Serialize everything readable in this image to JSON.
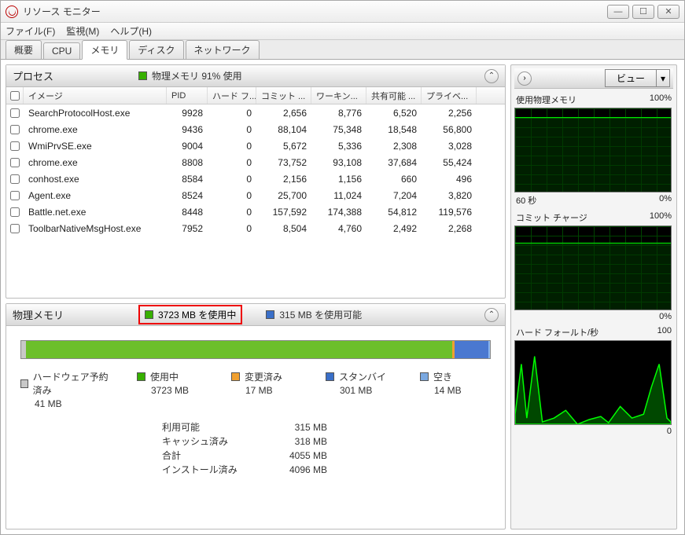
{
  "window": {
    "title": "リソース モニター"
  },
  "menu": {
    "file": "ファイル(F)",
    "monitor": "監視(M)",
    "help": "ヘルプ(H)"
  },
  "tabs": {
    "overview": "概要",
    "cpu": "CPU",
    "memory": "メモリ",
    "disk": "ディスク",
    "network": "ネットワーク"
  },
  "process_panel": {
    "title": "プロセス",
    "status": "物理メモリ 91% 使用",
    "cols": {
      "image": "イメージ",
      "pid": "PID",
      "hardfault": "ハード フ...",
      "commit": "コミット ...",
      "working": "ワーキン...",
      "shareable": "共有可能 ...",
      "private": "プライベ..."
    },
    "rows": [
      {
        "img": "SearchProtocolHost.exe",
        "pid": "9928",
        "hf": "0",
        "cm": "2,656",
        "ws": "8,776",
        "sh": "6,520",
        "pv": "2,256"
      },
      {
        "img": "chrome.exe",
        "pid": "9436",
        "hf": "0",
        "cm": "88,104",
        "ws": "75,348",
        "sh": "18,548",
        "pv": "56,800"
      },
      {
        "img": "WmiPrvSE.exe",
        "pid": "9004",
        "hf": "0",
        "cm": "5,672",
        "ws": "5,336",
        "sh": "2,308",
        "pv": "3,028"
      },
      {
        "img": "chrome.exe",
        "pid": "8808",
        "hf": "0",
        "cm": "73,752",
        "ws": "93,108",
        "sh": "37,684",
        "pv": "55,424"
      },
      {
        "img": "conhost.exe",
        "pid": "8584",
        "hf": "0",
        "cm": "2,156",
        "ws": "1,156",
        "sh": "660",
        "pv": "496"
      },
      {
        "img": "Agent.exe",
        "pid": "8524",
        "hf": "0",
        "cm": "25,700",
        "ws": "11,024",
        "sh": "7,204",
        "pv": "3,820"
      },
      {
        "img": "Battle.net.exe",
        "pid": "8448",
        "hf": "0",
        "cm": "157,592",
        "ws": "174,388",
        "sh": "54,812",
        "pv": "119,576"
      },
      {
        "img": "ToolbarNativeMsgHost.exe",
        "pid": "7952",
        "hf": "0",
        "cm": "8,504",
        "ws": "4,760",
        "sh": "2,492",
        "pv": "2,268"
      }
    ]
  },
  "memory_panel": {
    "title": "物理メモリ",
    "used_label": "3723 MB を使用中",
    "avail_label": "315 MB を使用可能",
    "bar": {
      "hw_pct": 1.0,
      "used_pct": 91.0,
      "mod_pct": 0.4,
      "sb_pct": 7.3,
      "free_pct": 0.3
    },
    "legend": {
      "hw": {
        "label": "ハードウェア予約済み",
        "value": "41 MB"
      },
      "used": {
        "label": "使用中",
        "value": "3723 MB"
      },
      "mod": {
        "label": "変更済み",
        "value": "17 MB"
      },
      "sb": {
        "label": "スタンバイ",
        "value": "301 MB"
      },
      "free": {
        "label": "空き",
        "value": "14 MB"
      }
    },
    "summary": {
      "avail": {
        "label": "利用可能",
        "value": "315 MB"
      },
      "cached": {
        "label": "キャッシュ済み",
        "value": "318 MB"
      },
      "total": {
        "label": "合計",
        "value": "4055 MB"
      },
      "installed": {
        "label": "インストール済み",
        "value": "4096 MB"
      }
    }
  },
  "right": {
    "view_btn": "ビュー",
    "graphs": {
      "used": {
        "title": "使用物理メモリ",
        "max": "100%",
        "left": "60 秒",
        "right": "0%"
      },
      "commit": {
        "title": "コミット チャージ",
        "max": "100%",
        "right": "0%"
      },
      "hf": {
        "title": "ハード フォールト/秒",
        "max": "100",
        "right": "0"
      }
    }
  }
}
